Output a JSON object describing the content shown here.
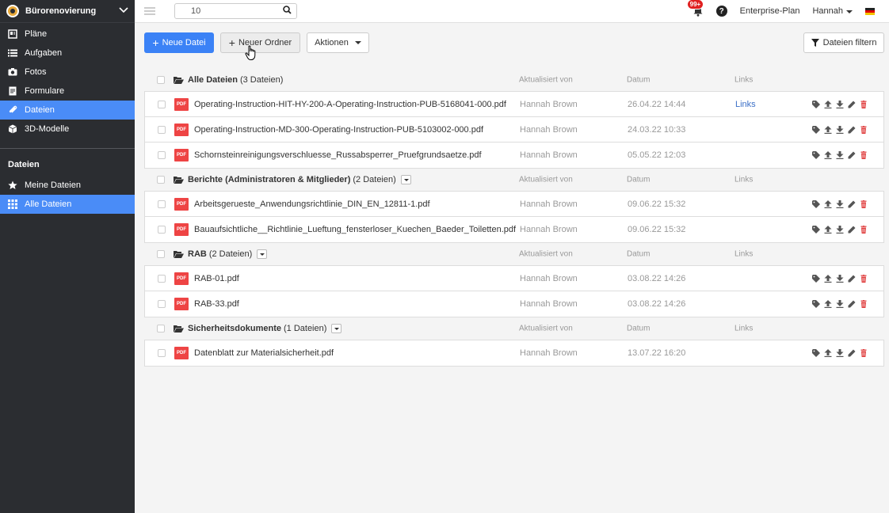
{
  "sidebar": {
    "project": "Bürorenovierung",
    "nav": [
      {
        "label": "Pläne",
        "icon": "map-icon"
      },
      {
        "label": "Aufgaben",
        "icon": "list-icon"
      },
      {
        "label": "Fotos",
        "icon": "camera-icon"
      },
      {
        "label": "Formulare",
        "icon": "form-icon"
      },
      {
        "label": "Dateien",
        "icon": "paperclip-icon",
        "active": true
      },
      {
        "label": "3D-Modelle",
        "icon": "cube-icon"
      }
    ],
    "section_title": "Dateien",
    "sub": [
      {
        "label": "Meine Dateien",
        "icon": "star-icon"
      },
      {
        "label": "Alle Dateien",
        "icon": "grid-icon",
        "active": true
      }
    ]
  },
  "topbar": {
    "search_value": "10",
    "badge": "99+",
    "plan": "Enterprise-Plan",
    "user": "Hannah"
  },
  "toolbar": {
    "new_file": "Neue Datei",
    "new_folder": "Neuer Ordner",
    "actions": "Aktionen",
    "filter": "Dateien filtern"
  },
  "columns": {
    "updated_by": "Aktualisiert von",
    "date": "Datum",
    "links": "Links"
  },
  "groups": [
    {
      "name": "Alle Dateien",
      "count": "(3 Dateien)",
      "dropdown": false,
      "files": [
        {
          "name": "Operating-Instruction-HIT-HY-200-A-Operating-Instruction-PUB-5168041-000.pdf",
          "by": "Hannah Brown",
          "date": "26.04.22 14:44",
          "link": "Links"
        },
        {
          "name": "Operating-Instruction-MD-300-Operating-Instruction-PUB-5103002-000.pdf",
          "by": "Hannah Brown",
          "date": "24.03.22 10:33",
          "link": ""
        },
        {
          "name": "Schornsteinreinigungsverschluesse_Russabsperrer_Pruefgrundsaetze.pdf",
          "by": "Hannah Brown",
          "date": "05.05.22 12:03",
          "link": ""
        }
      ]
    },
    {
      "name": "Berichte (Administratoren & Mitglieder)",
      "count": "(2 Dateien)",
      "dropdown": true,
      "files": [
        {
          "name": "Arbeitsgerueste_Anwendungsrichtlinie_DIN_EN_12811-1.pdf",
          "by": "Hannah Brown",
          "date": "09.06.22 15:32",
          "link": ""
        },
        {
          "name": "Bauaufsichtliche__Richtlinie_Lueftung_fensterloser_Kuechen_Baeder_Toiletten.pdf",
          "by": "Hannah Brown",
          "date": "09.06.22 15:32",
          "link": ""
        }
      ]
    },
    {
      "name": "RAB",
      "count": "(2 Dateien)",
      "dropdown": true,
      "files": [
        {
          "name": "RAB-01.pdf",
          "by": "Hannah Brown",
          "date": "03.08.22 14:26",
          "link": ""
        },
        {
          "name": "RAB-33.pdf",
          "by": "Hannah Brown",
          "date": "03.08.22 14:26",
          "link": ""
        }
      ]
    },
    {
      "name": "Sicherheitsdokumente",
      "count": "(1 Dateien)",
      "dropdown": true,
      "files": [
        {
          "name": "Datenblatt zur Materialsicherheit.pdf",
          "by": "Hannah Brown",
          "date": "13.07.22 16:20",
          "link": ""
        }
      ]
    }
  ],
  "file_type_label": "PDF",
  "colors": {
    "accent": "#3b82f6",
    "sidebar": "#2b2d31",
    "pdf": "#e44444",
    "delete": "#e04040"
  }
}
